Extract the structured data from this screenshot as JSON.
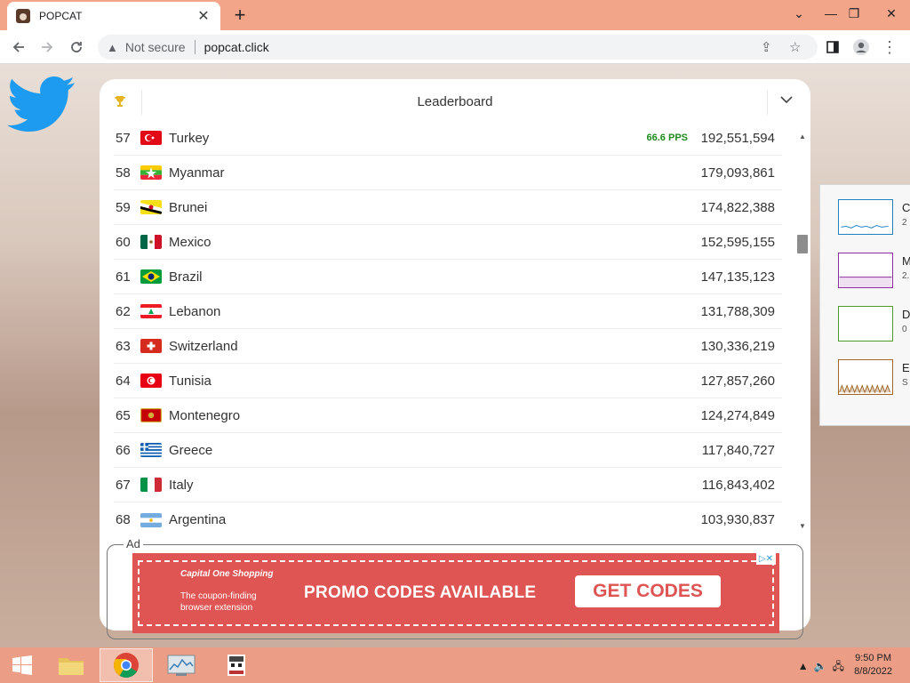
{
  "browser": {
    "tab_title": "POPCAT",
    "tab_close": "✕",
    "new_tab": "+",
    "not_secure": "Not secure",
    "url": "popcat.click"
  },
  "leaderboard": {
    "title": "Leaderboard",
    "rows": [
      {
        "rank": "57",
        "country": "Turkey",
        "pps": "66.6 PPS",
        "score": "192,551,594",
        "flag": "turkey"
      },
      {
        "rank": "58",
        "country": "Myanmar",
        "pps": "",
        "score": "179,093,861",
        "flag": "myanmar"
      },
      {
        "rank": "59",
        "country": "Brunei",
        "pps": "",
        "score": "174,822,388",
        "flag": "brunei"
      },
      {
        "rank": "60",
        "country": "Mexico",
        "pps": "",
        "score": "152,595,155",
        "flag": "mexico"
      },
      {
        "rank": "61",
        "country": "Brazil",
        "pps": "",
        "score": "147,135,123",
        "flag": "brazil"
      },
      {
        "rank": "62",
        "country": "Lebanon",
        "pps": "",
        "score": "131,788,309",
        "flag": "lebanon"
      },
      {
        "rank": "63",
        "country": "Switzerland",
        "pps": "",
        "score": "130,336,219",
        "flag": "switzerland"
      },
      {
        "rank": "64",
        "country": "Tunisia",
        "pps": "",
        "score": "127,857,260",
        "flag": "tunisia"
      },
      {
        "rank": "65",
        "country": "Montenegro",
        "pps": "",
        "score": "124,274,849",
        "flag": "montenegro"
      },
      {
        "rank": "66",
        "country": "Greece",
        "pps": "",
        "score": "117,840,727",
        "flag": "greece"
      },
      {
        "rank": "67",
        "country": "Italy",
        "pps": "",
        "score": "116,843,402",
        "flag": "italy"
      },
      {
        "rank": "68",
        "country": "Argentina",
        "pps": "",
        "score": "103,930,837",
        "flag": "argentina"
      }
    ]
  },
  "ad": {
    "label": "Ad",
    "brand": "Capital One Shopping",
    "tagline": "The coupon-finding browser extension",
    "headline": "PROMO CODES AVAILABLE",
    "cta": "GET CODES"
  },
  "monitor": [
    {
      "label": "C",
      "sub": "2",
      "color": "#1f7fbf"
    },
    {
      "label": "M",
      "sub": "2.",
      "color": "#8b2fa0"
    },
    {
      "label": "D",
      "sub": "0",
      "color": "#4e9a2b"
    },
    {
      "label": "E",
      "sub": "S",
      "color": "#a0672a"
    }
  ],
  "taskbar": {
    "time": "9:50 PM",
    "date": "8/8/2022"
  },
  "colors": {
    "tabstrip": "#f3a58a",
    "taskbar": "#ec9d85",
    "pps_green": "#1f8b1f",
    "ad_red": "#de5553"
  }
}
